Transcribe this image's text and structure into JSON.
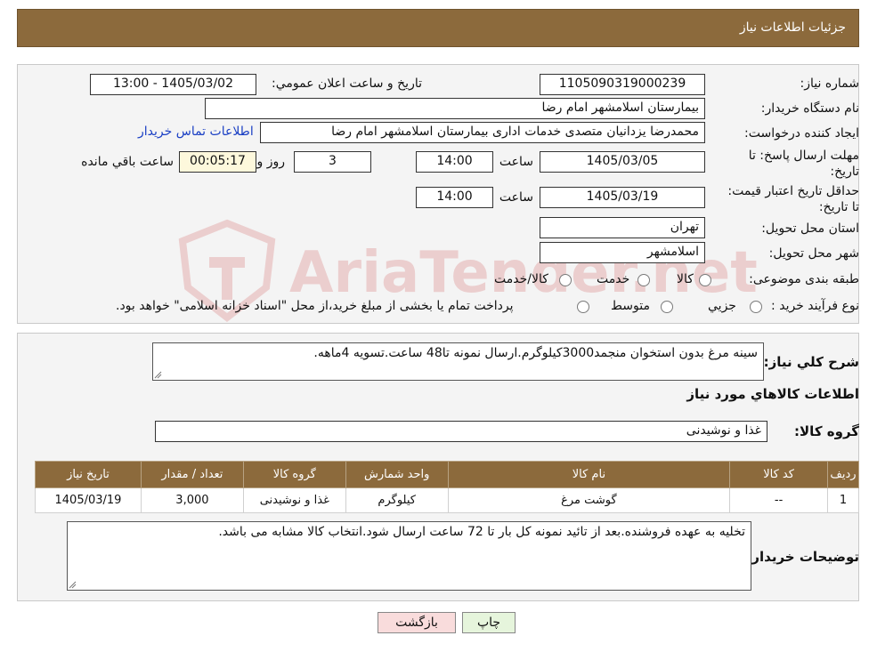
{
  "header": {
    "title": "جزئیات اطلاعات نیاز"
  },
  "form": {
    "need_number": {
      "label": "شماره نیاز:",
      "value": "1105090319000239"
    },
    "announce": {
      "label": "تاریخ و ساعت اعلان عمومي:",
      "value": "1405/03/02 - 13:00"
    },
    "buyer_org": {
      "label": "نام دستگاه خریدار:",
      "value": "بیمارستان اسلامشهر   امام رضا"
    },
    "requester": {
      "label": "ایجاد کننده درخواست:",
      "value": "محمدرضا یزدانیان متصدی خدمات اداری بیمارستان اسلامشهر   امام رضا"
    },
    "contact_link": "اطلاعات تماس خریدار",
    "deadline": {
      "label": "مهلت ارسال پاسخ: تا تاریخ:",
      "date": "1405/03/05",
      "time_label": "ساعت",
      "time": "14:00",
      "days": "3",
      "days_label": "روز و",
      "remaining": "00:05:17",
      "remaining_label": "ساعت باقي مانده"
    },
    "validity": {
      "label": "حداقل تاریخ اعتبار قیمت: تا تاریخ:",
      "date": "1405/03/19",
      "time_label": "ساعت",
      "time": "14:00"
    },
    "province": {
      "label": "استان محل تحویل:",
      "value": "تهران"
    },
    "city": {
      "label": "شهر محل تحویل:",
      "value": "اسلامشهر"
    },
    "category": {
      "label": "طبقه بندی موضوعی:",
      "options": [
        "کالا",
        "خدمت",
        "کالا/خدمت"
      ]
    },
    "purchase_type": {
      "label": "نوع فرآیند خرید :",
      "options": [
        "جزیي",
        "متوسط"
      ],
      "note": "پرداخت تمام یا بخشی از مبلغ خرید،از محل \"اسناد خزانه اسلامی\" خواهد بود."
    }
  },
  "summary": {
    "label": "شرح كلي نياز:",
    "value": "سینه مرغ بدون استخوان منجمد3000کیلوگرم.ارسال نمونه تا48 ساعت.تسویه 4ماهه."
  },
  "goods_section": {
    "title": "اطلاعات كالاهاي مورد نياز",
    "group_label": "گروه كالا:",
    "group_value": "غذا و نوشیدنی"
  },
  "table": {
    "headers": [
      "رديف",
      "کد کالا",
      "نام کالا",
      "واحد شمارش",
      "گروه کالا",
      "تعداد / مقدار",
      "تاریخ نیاز"
    ],
    "rows": [
      [
        "1",
        "--",
        "گوشت مرغ",
        "کیلوگرم",
        "غذا و نوشیدنی",
        "3,000",
        "1405/03/19"
      ]
    ]
  },
  "buyer_notes": {
    "label": "توضیحات خریدار:",
    "value": "تخلیه به عهده فروشنده.بعد از تائید نمونه کل بار تا 72 ساعت ارسال شود.انتخاب کالا مشابه می باشد."
  },
  "buttons": {
    "print": "چاپ",
    "back": "بازگشت"
  },
  "watermark": "AriaTender.net",
  "colors": {
    "header_bg": "#8c6a3c",
    "link": "#1a3fc4",
    "back_button_bg": "#f9dcdc",
    "print_button_bg": "#e6f5dc",
    "watermark": "#c62828"
  }
}
